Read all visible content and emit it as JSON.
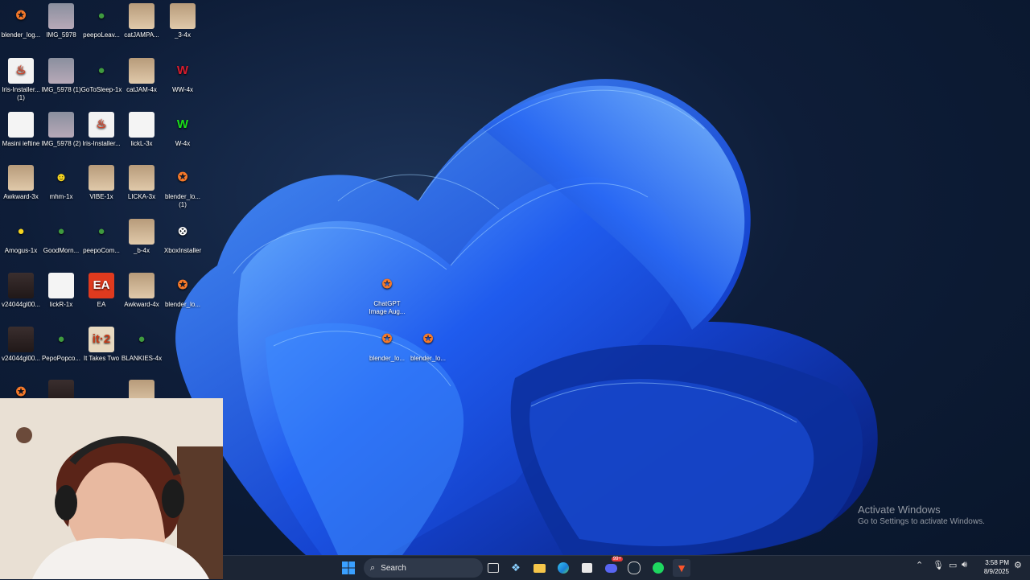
{
  "desktop": {
    "col1": [
      {
        "label": "blender_log...",
        "icon": "blender-icon"
      },
      {
        "label": "Iris-Installer...",
        "label2": "(1)",
        "icon": "java-icon"
      },
      {
        "label": "Masini ieftine",
        "icon": "file-icon"
      },
      {
        "label": "Awkward-3x",
        "icon": "cat-image-icon"
      },
      {
        "label": "Amogus-1x",
        "icon": "amogus-icon"
      },
      {
        "label": "v24044gl00...",
        "icon": "video-icon"
      },
      {
        "label": "v24044gl00...",
        "icon": "video-icon"
      },
      {
        "label": "",
        "icon": "blender-icon"
      }
    ],
    "col2": [
      {
        "label": "IMG_5978",
        "icon": "photo-icon"
      },
      {
        "label": "IMG_5978 (1)",
        "icon": "photo-icon"
      },
      {
        "label": "IMG_5978 (2)",
        "icon": "photo-icon"
      },
      {
        "label": "mhm-1x",
        "icon": "emoji-icon"
      },
      {
        "label": "GoodMorn...",
        "icon": "pepe-icon"
      },
      {
        "label": "lickR-1x",
        "icon": "image-icon"
      },
      {
        "label": "PepoPopco...",
        "icon": "pepe-icon"
      },
      {
        "label": "",
        "icon": "image-icon"
      }
    ],
    "col3": [
      {
        "label": "peepoLeav...",
        "icon": "pepe-icon"
      },
      {
        "label": "GoToSleep-1x",
        "icon": "pepe-icon"
      },
      {
        "label": "Iris-Installer...",
        "icon": "java-icon"
      },
      {
        "label": "VIBE-1x",
        "icon": "image-icon"
      },
      {
        "label": "peepoCom...",
        "icon": "pepe-icon"
      },
      {
        "label": "EA",
        "icon": "ea-icon"
      },
      {
        "label": "It Takes Two",
        "icon": "game-icon"
      }
    ],
    "col4": [
      {
        "label": "catJAMPA...",
        "icon": "cat-image-icon"
      },
      {
        "label": "catJAM-4x",
        "icon": "cat-image-icon"
      },
      {
        "label": "lickL-3x",
        "icon": "image-icon"
      },
      {
        "label": "LICKA-3x",
        "icon": "image-icon"
      },
      {
        "label": "_b-4x",
        "icon": "cat-image-icon"
      },
      {
        "label": "Awkward-4x",
        "icon": "cat-image-icon"
      },
      {
        "label": "BLANKIES-4x",
        "icon": "pepe-icon"
      },
      {
        "label": "",
        "icon": "cat-image-icon"
      }
    ],
    "col5": [
      {
        "label": "_3-4x",
        "icon": "cat-image-icon"
      },
      {
        "label": "WW-4x",
        "icon": "w-icon"
      },
      {
        "label": "W-4x",
        "icon": "w-icon"
      },
      {
        "label": "blender_lo...",
        "label2": "(1)",
        "icon": "blender-icon"
      },
      {
        "label": "XboxInstaller",
        "icon": "xbox-icon"
      },
      {
        "label": "blender_lo...",
        "icon": "blender-icon"
      }
    ],
    "floating": [
      {
        "label": "ChatGPT",
        "label2": "Image Aug...",
        "icon": "blender-icon"
      },
      {
        "label": "blender_lo...",
        "icon": "blender-icon"
      },
      {
        "label": "blender_lo...",
        "icon": "blender-icon"
      }
    ]
  },
  "watermark": {
    "title": "Activate Windows",
    "subtitle": "Go to Settings to activate Windows."
  },
  "taskbar": {
    "search_label": "Search",
    "clock_time": "3:58 PM",
    "clock_date": "8/9/2025",
    "discord_badge": "99+"
  },
  "colors": {
    "taskbar_bg": "#1c2534",
    "accent": "#0a84ff",
    "blender_orange": "#f5792a"
  }
}
